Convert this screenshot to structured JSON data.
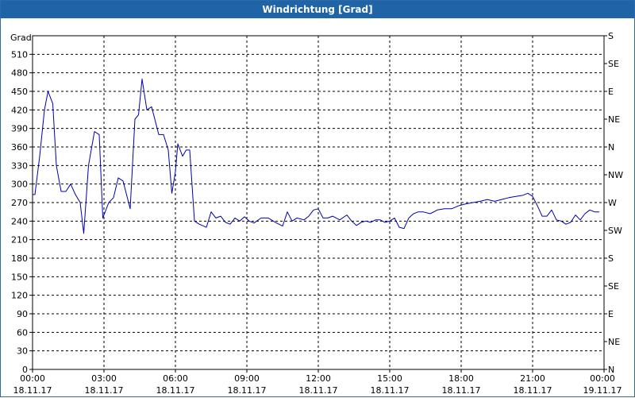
{
  "window": {
    "title": "Windrichtung [Grad]"
  },
  "chart_data": {
    "type": "line",
    "title": "Windrichtung [Grad]",
    "ylabel": "Grad",
    "ylim": [
      0,
      540
    ],
    "y_ticks": [
      0,
      30,
      60,
      90,
      120,
      150,
      180,
      210,
      240,
      270,
      300,
      330,
      360,
      390,
      420,
      450,
      480,
      510
    ],
    "xlim": [
      0,
      24
    ],
    "x_ticks": [
      {
        "x": 0,
        "time": "00:00",
        "date": "18.11.17"
      },
      {
        "x": 3,
        "time": "03:00",
        "date": "18.11.17"
      },
      {
        "x": 6,
        "time": "06:00",
        "date": "18.11.17"
      },
      {
        "x": 9,
        "time": "09:00",
        "date": "18.11.17"
      },
      {
        "x": 12,
        "time": "12:00",
        "date": "18.11.17"
      },
      {
        "x": 15,
        "time": "15:00",
        "date": "18.11.17"
      },
      {
        "x": 18,
        "time": "18:00",
        "date": "18.11.17"
      },
      {
        "x": 21,
        "time": "21:00",
        "date": "18.11.17"
      },
      {
        "x": 24,
        "time": "00:00",
        "date": "19.11.17"
      }
    ],
    "right_axis_labels": [
      {
        "value": 540,
        "label": "S"
      },
      {
        "value": 495,
        "label": "SE"
      },
      {
        "value": 450,
        "label": "E"
      },
      {
        "value": 405,
        "label": "NE"
      },
      {
        "value": 360,
        "label": "N"
      },
      {
        "value": 315,
        "label": "NW"
      },
      {
        "value": 270,
        "label": "W"
      },
      {
        "value": 225,
        "label": "SW"
      },
      {
        "value": 180,
        "label": "S"
      },
      {
        "value": 135,
        "label": "SE"
      },
      {
        "value": 90,
        "label": "E"
      },
      {
        "value": 45,
        "label": "NE"
      },
      {
        "value": 0,
        "label": "N"
      }
    ],
    "grid": true,
    "line_color": "#0000aa",
    "series": [
      {
        "x": [
          0,
          0.1,
          0.3,
          0.5,
          0.65,
          0.85,
          1.0,
          1.2,
          1.4,
          1.6,
          1.8,
          2.0,
          2.15,
          2.35,
          2.6,
          2.8,
          2.95,
          3.2,
          3.4,
          3.6,
          3.8,
          4.1,
          4.3,
          4.45,
          4.6,
          4.8,
          5.0,
          5.3,
          5.5,
          5.7,
          5.85,
          6.0,
          6.1,
          6.3,
          6.45,
          6.6,
          6.8,
          7.0,
          7.3,
          7.5,
          7.7,
          7.9,
          8.1,
          8.3,
          8.5,
          8.7,
          8.9,
          9.1,
          9.3,
          9.6,
          9.9,
          10.2,
          10.5,
          10.7,
          10.9,
          11.1,
          11.4,
          11.6,
          11.8,
          12.0,
          12.2,
          12.4,
          12.6,
          12.9,
          13.2,
          13.4,
          13.6,
          13.8,
          14.0,
          14.2,
          14.4,
          14.6,
          14.8,
          15.0,
          15.2,
          15.4,
          15.6,
          15.8,
          16.0,
          16.2,
          16.4,
          16.7,
          17.0,
          17.3,
          17.6,
          17.9,
          18.2,
          18.5,
          18.8,
          19.1,
          19.4,
          19.7,
          20.0,
          20.3,
          20.6,
          20.8,
          21.0,
          21.2,
          21.4,
          21.6,
          21.8,
          22.0,
          22.2,
          22.4,
          22.6,
          22.8,
          23.0,
          23.2,
          23.4,
          23.6,
          23.8
        ],
        "y": [
          283,
          283,
          345,
          420,
          450,
          430,
          330,
          288,
          288,
          300,
          283,
          270,
          220,
          330,
          385,
          380,
          245,
          270,
          278,
          310,
          305,
          260,
          405,
          412,
          470,
          420,
          425,
          380,
          380,
          355,
          285,
          320,
          365,
          345,
          355,
          355,
          240,
          235,
          230,
          255,
          245,
          248,
          238,
          235,
          245,
          240,
          247,
          240,
          237,
          245,
          245,
          238,
          232,
          255,
          240,
          245,
          242,
          248,
          258,
          260,
          245,
          245,
          248,
          242,
          250,
          240,
          233,
          238,
          240,
          238,
          242,
          242,
          238,
          240,
          245,
          230,
          228,
          245,
          252,
          255,
          255,
          252,
          258,
          260,
          260,
          265,
          268,
          270,
          272,
          275,
          272,
          275,
          278,
          280,
          282,
          285,
          280,
          265,
          248,
          248,
          258,
          242,
          240,
          235,
          238,
          250,
          242,
          252,
          258,
          255,
          255
        ]
      }
    ]
  }
}
